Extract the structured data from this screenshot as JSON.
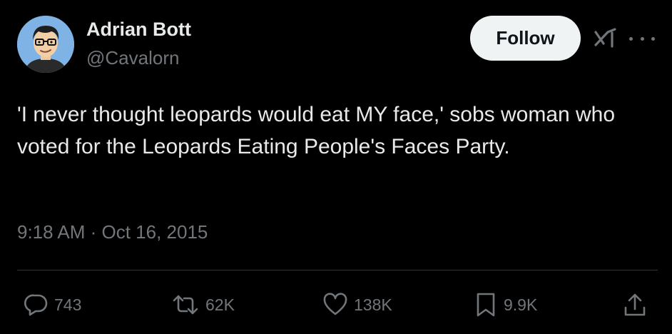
{
  "author": {
    "name": "Adrian Bott",
    "handle": "@Cavalorn"
  },
  "header": {
    "follow_label": "Follow",
    "icons": [
      "grok-icon",
      "more-icon"
    ]
  },
  "tweet": {
    "text": "'I never thought leopards would eat MY face,' sobs woman who voted for the Leopards Eating People's Faces Party.",
    "timestamp": "9:18 AM · Oct 16, 2015"
  },
  "actions": {
    "replies": "743",
    "reposts": "62K",
    "likes": "138K",
    "bookmarks": "9.9K"
  },
  "colors": {
    "background": "#000000",
    "primary_text": "#e7e9ea",
    "secondary_text": "#71767b",
    "follow_bg": "#eff3f4",
    "divider": "#2f3336",
    "avatar_bg": "#7fb3e6"
  }
}
